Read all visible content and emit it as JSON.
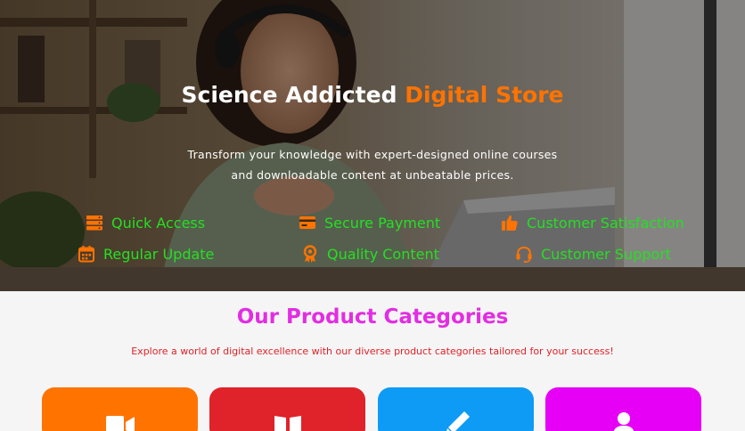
{
  "hero": {
    "title_main": "Science Addicted ",
    "title_accent": "Digital Store",
    "description": "Transform your knowledge with expert-designed online courses and downloadable content at unbeatable prices.",
    "features": [
      {
        "label": "Quick Access",
        "icon": "server-icon"
      },
      {
        "label": "Secure Payment",
        "icon": "credit-card-icon"
      },
      {
        "label": "Customer Satisfaction",
        "icon": "thumbs-up-icon"
      },
      {
        "label": "Regular Update",
        "icon": "calendar-icon"
      },
      {
        "label": "Quality Content",
        "icon": "award-icon"
      },
      {
        "label": "Customer Support",
        "icon": "headset-icon"
      }
    ],
    "colors": {
      "accent": "#ff7300",
      "feature_text": "#22e122",
      "icon": "#ff7300"
    }
  },
  "categories": {
    "title": "Our Product Categories",
    "subtitle": "Explore a world of digital excellence with our diverse product categories tailored for your success!",
    "cards": [
      {
        "icon": "video-camera-icon",
        "color": "#ff7300"
      },
      {
        "icon": "book-icon",
        "color": "#e0222a"
      },
      {
        "icon": "pencil-icon",
        "color": "#0d9bf5"
      },
      {
        "icon": "user-icon",
        "color": "#e600f5"
      }
    ],
    "colors": {
      "title": "#e22ee2",
      "subtitle": "#e0222a"
    }
  }
}
